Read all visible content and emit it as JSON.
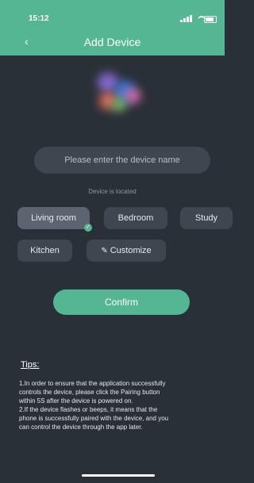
{
  "status_bar": {
    "time": "15:12"
  },
  "header": {
    "back_icon": "chevron-left-icon",
    "title": "Add Device"
  },
  "device_name_input": {
    "placeholder": "Please enter the device name",
    "value": ""
  },
  "location": {
    "label": "Device is located",
    "rooms": [
      {
        "label": "Living room",
        "selected": true
      },
      {
        "label": "Bedroom",
        "selected": false
      },
      {
        "label": "Study",
        "selected": false
      },
      {
        "label": "Kitchen",
        "selected": false
      },
      {
        "label": "Customize",
        "icon": "pencil-icon",
        "selected": false
      }
    ]
  },
  "confirm_label": "Confirm",
  "tips": {
    "title": "Tips:",
    "lines": [
      "1.In order to ensure that the application successfully",
      "controls the device, please click the Pairing button",
      "within 5S after the device is powered on.",
      "2.If the device flashes or beeps, it means that the",
      "phone is successfully paired with the device, and you",
      "can control the device through the app later."
    ]
  },
  "colors": {
    "accent": "#55b693",
    "background": "#2a3037",
    "button_bg": "#3e4650"
  }
}
